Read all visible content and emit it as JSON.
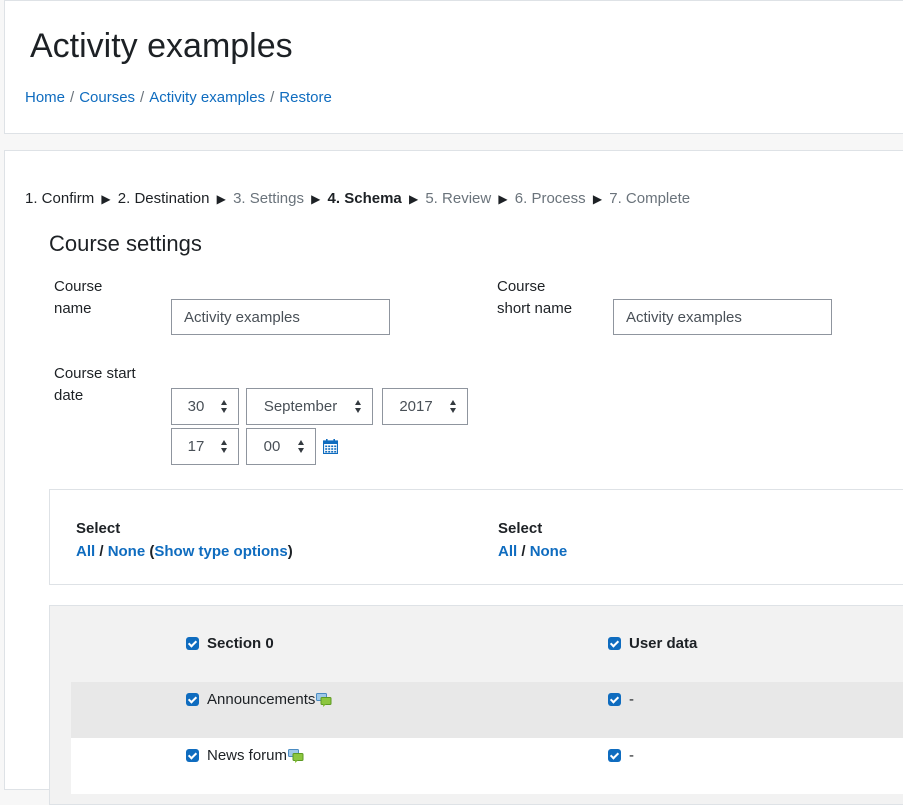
{
  "header": {
    "title": "Activity examples",
    "breadcrumb": [
      "Home",
      "Courses",
      "Activity examples",
      "Restore"
    ],
    "separator": "/"
  },
  "stepper": {
    "arrow": "▶",
    "steps": [
      {
        "label": "1. Confirm",
        "state": "done"
      },
      {
        "label": "2. Destination",
        "state": "done"
      },
      {
        "label": "3. Settings",
        "state": "future"
      },
      {
        "label": "4. Schema",
        "state": "current"
      },
      {
        "label": "5. Review",
        "state": "future"
      },
      {
        "label": "6. Process",
        "state": "future"
      },
      {
        "label": "7. Complete",
        "state": "future"
      }
    ]
  },
  "course_settings": {
    "title": "Course settings",
    "course_name_label_1": "Course",
    "course_name_label_2": "name",
    "course_name_value": "Activity examples",
    "short_name_label_1": "Course",
    "short_name_label_2": "short name",
    "short_name_value": "Activity examples",
    "start_date_label_1": "Course start",
    "start_date_label_2": "date",
    "day": "30",
    "month": "September",
    "year": "2017",
    "hour": "17",
    "minute": "00"
  },
  "select_panel": {
    "left": {
      "heading": "Select",
      "all": "All",
      "slash": " / ",
      "none": "None",
      "open": " (",
      "type_options": "Show type options",
      "close": ")"
    },
    "right": {
      "heading": "Select",
      "all": "All",
      "slash": " / ",
      "none": "None"
    }
  },
  "schema": {
    "header": {
      "section": "Section 0",
      "user_data": "User data"
    },
    "rows": [
      {
        "name": "Announcements",
        "user_data": "-"
      },
      {
        "name": "News forum",
        "user_data": "-"
      }
    ]
  },
  "colors": {
    "link": "#0f6cbf",
    "checkbox": "#0f6cbf",
    "text": "#1d2125",
    "muted": "#6a737b"
  },
  "icons": {
    "calendar": "calendar-icon",
    "forum": "forum-icon",
    "dropdown": "chevron-updown-icon"
  }
}
